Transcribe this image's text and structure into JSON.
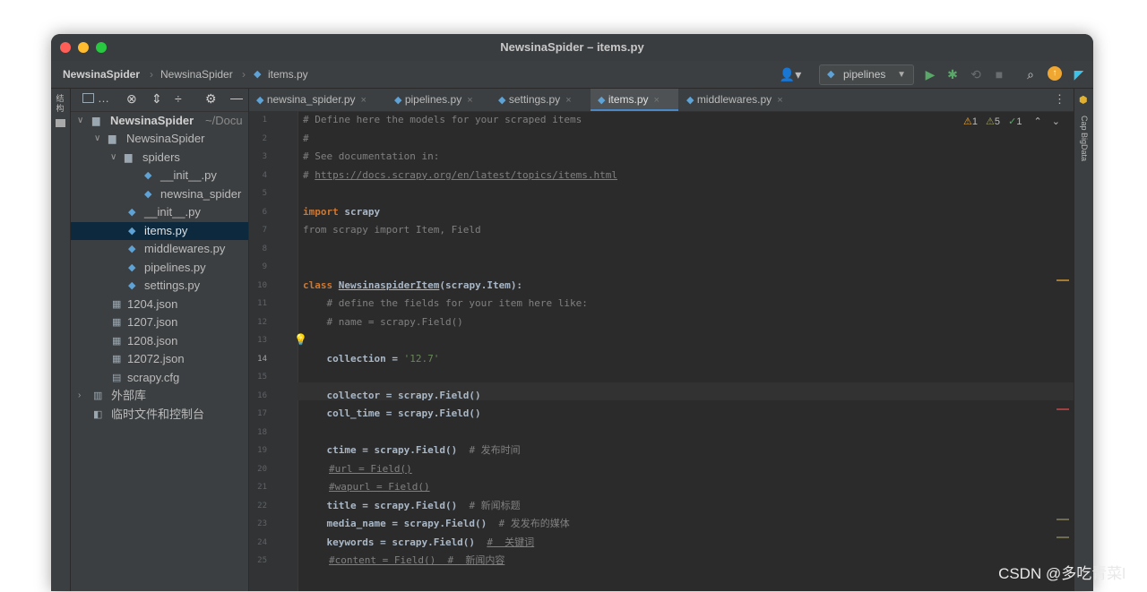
{
  "window": {
    "title": "NewsinaSpider – items.py"
  },
  "breadcrumbs": [
    "NewsinaSpider",
    "NewsinaSpider",
    "items.py"
  ],
  "toolbar": {
    "run_config": "pipelines"
  },
  "project": {
    "root_label": "NewsinaSpider",
    "root_path": "~/Docu",
    "items": [
      {
        "label": "NewsinaSpider"
      },
      {
        "label": "spiders"
      },
      {
        "label": "__init__.py"
      },
      {
        "label": "newsina_spider"
      },
      {
        "label": "__init__.py"
      },
      {
        "label": "items.py"
      },
      {
        "label": "middlewares.py"
      },
      {
        "label": "pipelines.py"
      },
      {
        "label": "settings.py"
      },
      {
        "label": "1204.json"
      },
      {
        "label": "1207.json"
      },
      {
        "label": "1208.json"
      },
      {
        "label": "12072.json"
      },
      {
        "label": "scrapy.cfg"
      },
      {
        "label": "外部库"
      },
      {
        "label": "临时文件和控制台"
      }
    ]
  },
  "left_strip": {
    "label": "结构"
  },
  "right_strip": {
    "label": "Cap BigData"
  },
  "tabs": [
    {
      "label": "newsina_spider.py"
    },
    {
      "label": "pipelines.py"
    },
    {
      "label": "settings.py"
    },
    {
      "label": "items.py"
    },
    {
      "label": "middlewares.py"
    }
  ],
  "inspections": {
    "warnings": "1",
    "weak_warnings": "5",
    "ok": "1"
  },
  "code": {
    "line_numbers": [
      "1",
      "2",
      "3",
      "4",
      "5",
      "6",
      "7",
      "8",
      "9",
      "10",
      "11",
      "12",
      "13",
      "14",
      "15",
      "16",
      "17",
      "18",
      "19",
      "20",
      "21",
      "22",
      "23",
      "24",
      "25"
    ],
    "l1": "# Define here the models for your scraped items",
    "l2": "#",
    "l3": "# See documentation in:",
    "l4_hash": "# ",
    "l4_link": "https://docs.scrapy.org/en/latest/topics/items.html",
    "l6_kw": "import",
    "l6_rest": " scrapy",
    "l7": "from scrapy import Item, Field",
    "l10_kw": "class",
    "l10_name": "NewsinaspiderItem",
    "l10_rest": "(scrapy.Item):",
    "l11": "    # define the fields for your item here like:",
    "l12": "    # name = scrapy.Field()",
    "l14_code": "    collection = ",
    "l14_str": "'12.7'",
    "l16": "    collector = scrapy.Field()",
    "l17": "    coll_time = scrapy.Field()",
    "l19_code": "    ctime = scrapy.Field()  ",
    "l19_com": "# 发布时间",
    "l20": "#url = Field()",
    "l21": "#wapurl = Field()",
    "l22_code": "    title = scrapy.Field()  ",
    "l22_com": "# 新闻标题",
    "l23_code": "    media_name = scrapy.Field()  ",
    "l23_com": "# 发发布的媒体",
    "l24_code": "    keywords = scrapy.Field()  ",
    "l24_com": "#  关键词",
    "l25": "#content = Field()  #  新闻内容"
  },
  "watermark": "CSDN @多吃青菜l"
}
